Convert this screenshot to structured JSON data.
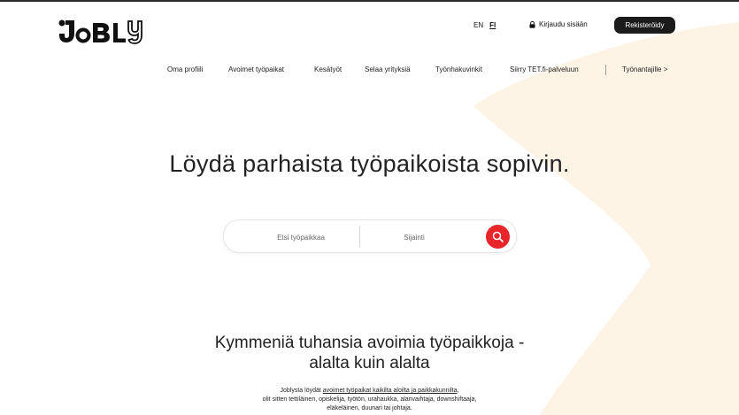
{
  "brand": {
    "logo_text": "JoBLY"
  },
  "header": {
    "languages": [
      {
        "code": "EN",
        "active": false
      },
      {
        "code": "FI",
        "active": true
      }
    ],
    "login_label": "Kirjaudu sisään",
    "register_label": "Rekisteröidy"
  },
  "nav": {
    "items": [
      "Oma profiili",
      "Avoimet työpaikat",
      "Kesätyöt",
      "Selaa yrityksiä",
      "Työnhakuvinkit",
      "Siirry TET.fi-palveluun"
    ],
    "employers_label": "Työnantajille >"
  },
  "hero": {
    "title": "Löydä parhaista työpaikoista sopivin.",
    "search_job_placeholder": "Etsi työpaikkaa",
    "search_location_placeholder": "Sijainti"
  },
  "section": {
    "title_line1": "Kymmeniä tuhansia avoimia työpaikkoja -",
    "title_line2": "alalta kuin alalta",
    "text_prefix": "Joblysta löydät ",
    "text_link": "avoimet työpaikat kaikilta aloilta ja paikkakunnilta",
    "text_suffix": ",",
    "text_line2": "olit sitten tettiläinen, opiskelija, työtön, urahaukka, alanvaihtaja, downshiftaaja,",
    "text_line3": "eläkeläinen, duunari tai johtaja."
  },
  "colors": {
    "accent": "#e8262a",
    "dark": "#1b1b1b",
    "cream": "#fdf4e5"
  }
}
